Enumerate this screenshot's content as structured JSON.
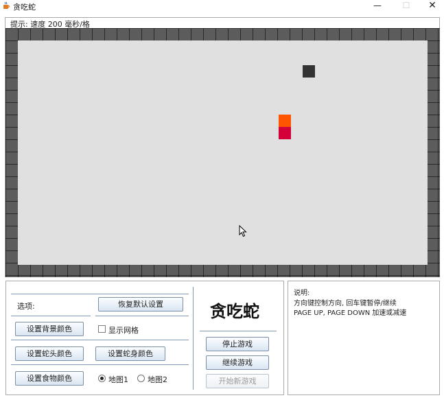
{
  "window": {
    "title": "贪吃蛇",
    "minimize_glyph": "—",
    "maximize_glyph": "☐",
    "close_glyph": "✕",
    "icon": "java-cup-icon"
  },
  "hint": {
    "text": "提示: 速度 200 毫秒/格"
  },
  "board": {
    "wall_color": "#5c5c5c",
    "background_color": "#e0e0e0",
    "food_color": "#333333",
    "snake_head_color": "#ff5500",
    "snake_body_color": "#d4003a"
  },
  "options": {
    "label": "选项:",
    "reset_defaults": "恢复默认设置",
    "set_background_color": "设置背景颜色",
    "show_grid": "显示网格",
    "show_grid_checked": false,
    "set_head_color": "设置蛇头颜色",
    "set_body_color": "设置蛇身颜色",
    "set_food_color": "设置食物颜色",
    "map1": "地图1",
    "map2": "地图2",
    "selected_map": "地图1"
  },
  "game": {
    "title": "贪吃蛇",
    "stop": "停止游戏",
    "continue": "继续游戏",
    "new_game": "开始新游戏",
    "new_game_enabled": false
  },
  "instructions": {
    "title": "说明:",
    "line1": "方向键控制方向, 回车键暂停/继续",
    "line2": "PAGE UP, PAGE DOWN 加速或减速"
  }
}
